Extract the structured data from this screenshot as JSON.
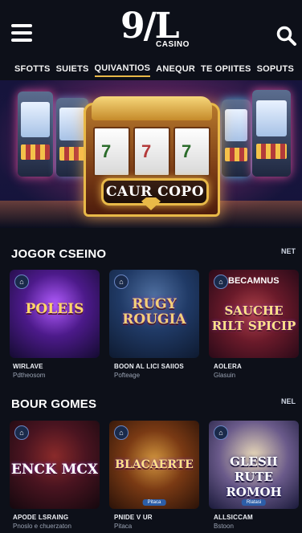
{
  "header": {
    "logo_mark": "9/L",
    "logo_sub": "CASINO"
  },
  "nav": {
    "items": [
      {
        "label": "SFOTTS",
        "active": false
      },
      {
        "label": "SUIETS",
        "active": false
      },
      {
        "label": "QUIVANTIOS",
        "active": true
      },
      {
        "label": "ANEQUR",
        "active": false
      },
      {
        "label": "TE OPIITES",
        "active": false
      },
      {
        "label": "SOPUTS",
        "active": false
      }
    ]
  },
  "hero": {
    "banner_text": "CAUR COPO"
  },
  "sections": [
    {
      "title": "JOGOR CSEINO",
      "more": "NET",
      "cards": [
        {
          "art_text": "POLEIS",
          "title": "WIRLAVE",
          "sub": "Pdtheosom",
          "pill": ""
        },
        {
          "art_text": "RUGY ROUGIA",
          "title": "BOON AL LICI SAIIOS",
          "sub": "Pofteage",
          "pill": ""
        },
        {
          "art_text": "SAUCHE RILT SPICIP",
          "title": "AOLERA",
          "sub": "Glasuin",
          "pill": "",
          "top_text": "BECAMNUS"
        }
      ]
    },
    {
      "title": "BOUR GOMES",
      "more": "NEL",
      "cards": [
        {
          "art_text": "ENCK MCX",
          "title": "APODE LSRAING",
          "sub": "Pnoslo e chuerzaton",
          "pill": ""
        },
        {
          "art_text": "BLACAERTE",
          "title": "PNIDE V UR",
          "sub": "Pitaca",
          "pill": "Pitaca"
        },
        {
          "art_text": "GLESII RUTE ROMOH",
          "title": "ALLSICCAM",
          "sub": "Bstoon",
          "pill": "Rlatasi"
        }
      ]
    }
  ],
  "colors": {
    "background": "#0d1019",
    "accent": "#e8b948"
  }
}
